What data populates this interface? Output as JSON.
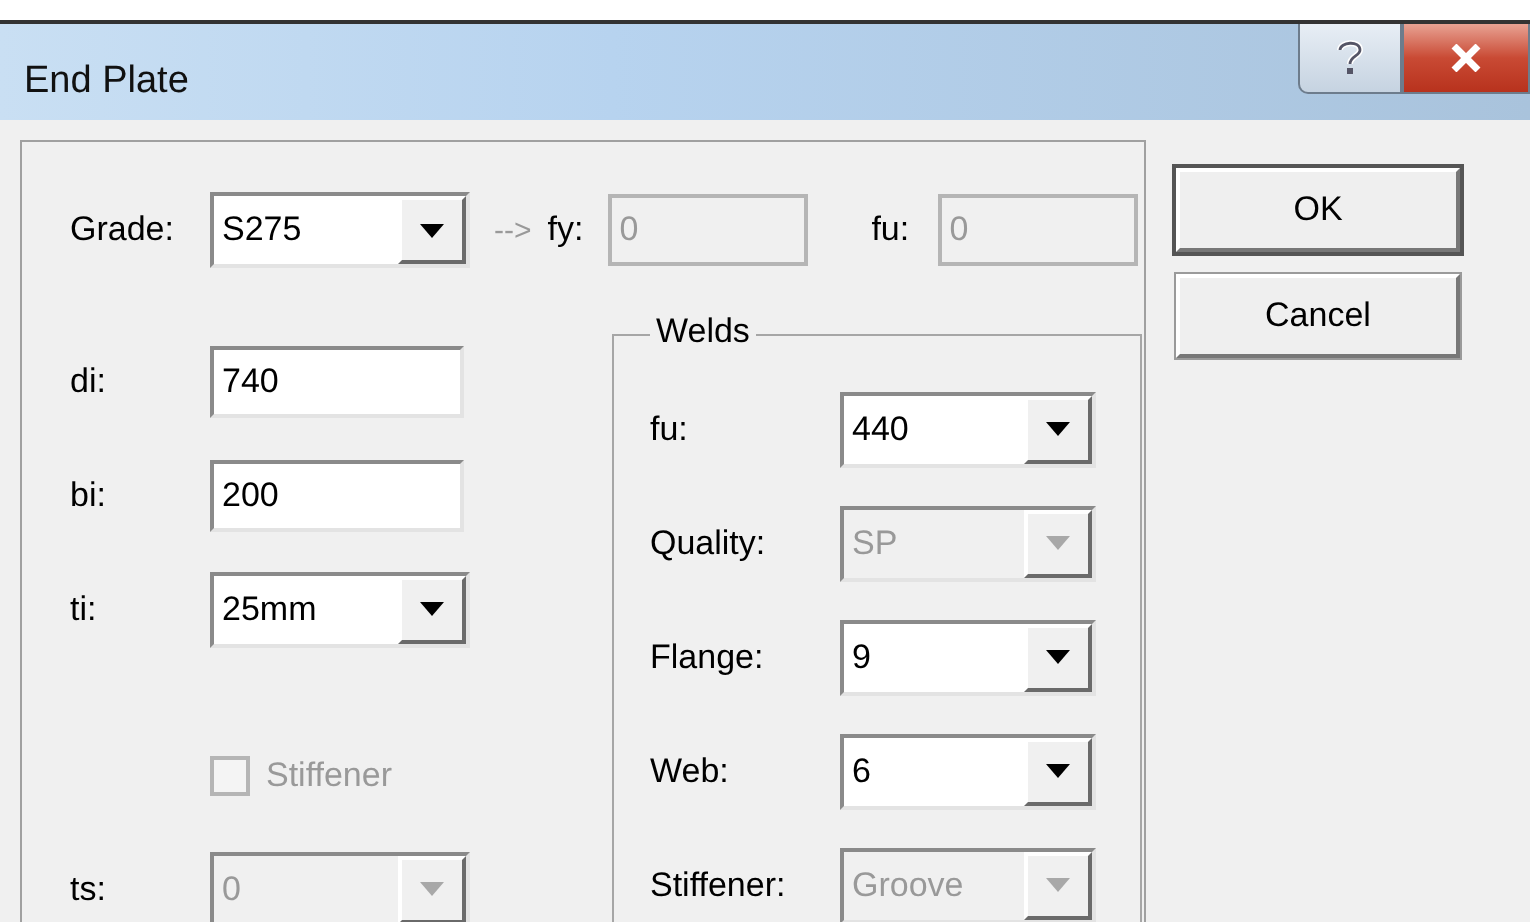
{
  "window": {
    "title": "End Plate"
  },
  "grade": {
    "label": "Grade:",
    "value": "S275",
    "disabled": false
  },
  "arrow": "-->",
  "fy": {
    "label": "fy:",
    "value": "0",
    "disabled": true
  },
  "fu": {
    "label": "fu:",
    "value": "0",
    "disabled": true
  },
  "fields": [
    {
      "kind": "text",
      "label": "di:",
      "value": "740",
      "disabled": false
    },
    {
      "kind": "text",
      "label": "bi:",
      "value": "200",
      "disabled": false
    },
    {
      "kind": "combo",
      "label": "ti:",
      "value": "25mm",
      "disabled": false
    },
    {
      "kind": "checkbox",
      "label": "Stiffener",
      "checked": false,
      "disabled": true
    },
    {
      "kind": "combo",
      "label": "ts:",
      "value": "0",
      "disabled": true
    }
  ],
  "welds": {
    "title": "Welds",
    "fields": [
      {
        "label": "fu:",
        "value": "440",
        "disabled": false
      },
      {
        "label": "Quality:",
        "value": "SP",
        "disabled": true
      },
      {
        "label": "Flange:",
        "value": "9",
        "disabled": false
      },
      {
        "label": "Web:",
        "value": "6",
        "disabled": false
      },
      {
        "label": "Stiffener:",
        "value": "Groove",
        "disabled": true
      }
    ]
  },
  "buttons": [
    {
      "label": "OK",
      "default": true
    },
    {
      "label": "Cancel",
      "default": false
    }
  ]
}
